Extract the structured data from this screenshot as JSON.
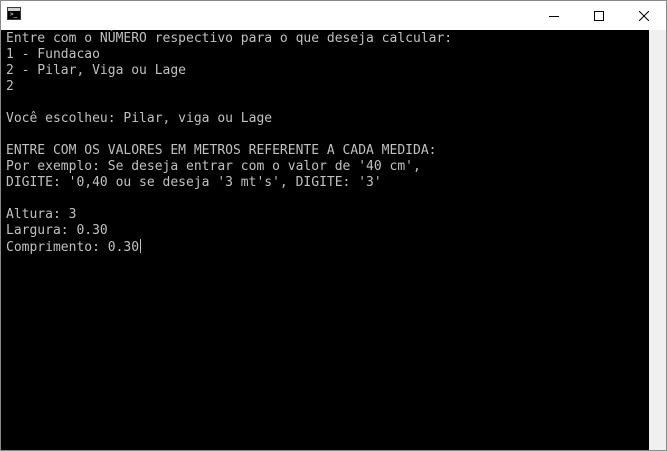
{
  "window": {
    "title": ""
  },
  "console": {
    "lines": [
      "Entre com o NÚMERO respectivo para o que deseja calcular:",
      "1 - Fundacao",
      "2 - Pilar, Viga ou Lage",
      "2",
      "",
      "Você escolheu: Pilar, viga ou Lage",
      "",
      "ENTRE COM OS VALORES EM METROS REFERENTE A CADA MEDIDA:",
      "Por exemplo: Se deseja entrar com o valor de '40 cm',",
      "DIGITE: '0,40 ou se deseja '3 mt's', DIGITE: '3'",
      "",
      "Altura: 3",
      "Largura: 0.30",
      "Comprimento: 0.30"
    ],
    "text_color": "#c0c0c0",
    "background": "#000000"
  },
  "icons": {
    "app": "console-app-icon",
    "minimize": "minimize-icon",
    "maximize": "maximize-icon",
    "close": "close-icon"
  }
}
